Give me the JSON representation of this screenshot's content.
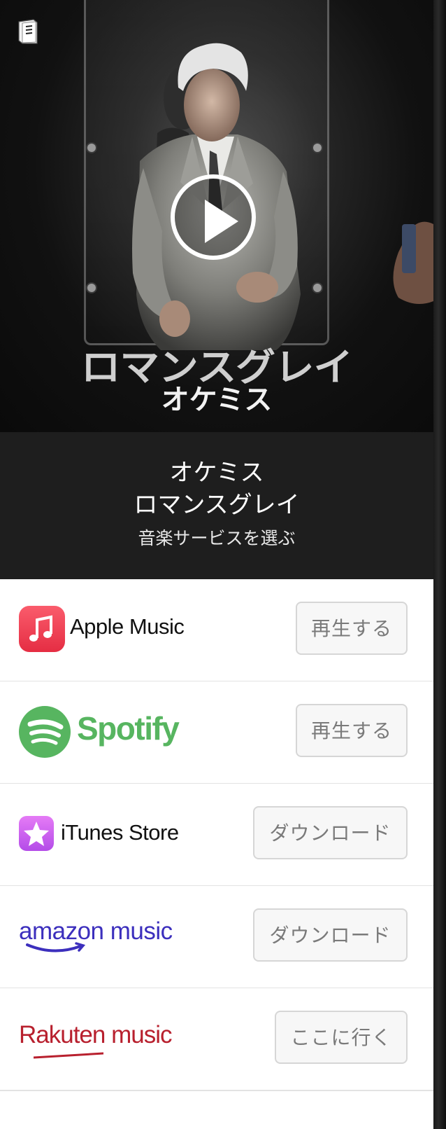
{
  "artist": "オケミス",
  "song_title": "ロマンスグレイ",
  "choose_service": "音楽サービスを選ぶ",
  "cover_art": {
    "title_text": "ロマンスグレイ",
    "artist_text": "オケミス"
  },
  "services": [
    {
      "name": "Apple Music",
      "button": "再生する",
      "icon": "apple-music-icon",
      "color": "#f1434f"
    },
    {
      "name": "Spotify",
      "button": "再生する",
      "icon": "spotify-icon",
      "color": "#1ed760"
    },
    {
      "name": "iTunes Store",
      "button": "ダウンロード",
      "icon": "itunes-star-icon",
      "color": "#c45cf0"
    },
    {
      "name": "amazon music",
      "button": "ダウンロード",
      "icon": "amazon-music-logo",
      "color": "#4a3cdb"
    },
    {
      "name": "Rakuten music",
      "button": "ここに行く",
      "icon": "rakuten-music-logo",
      "color": "#bf1c2b"
    }
  ]
}
